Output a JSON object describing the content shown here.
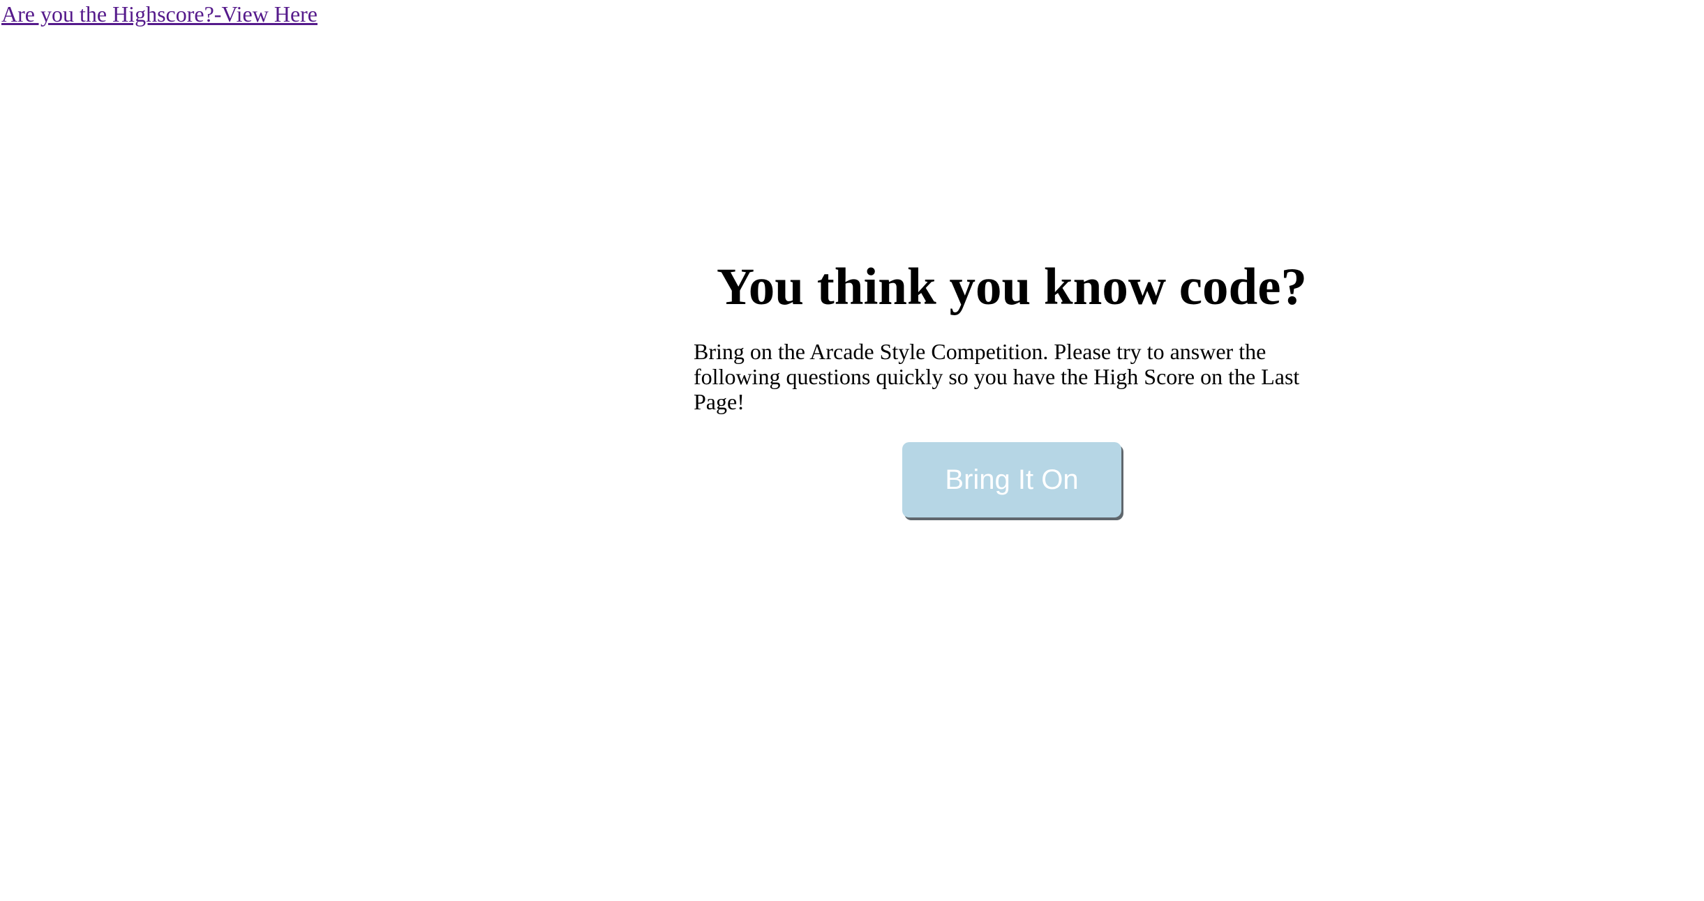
{
  "nav": {
    "highscore_link": "Are you the Highscore?-View Here"
  },
  "main": {
    "title": "You think you know code?",
    "intro": "Bring on the Arcade Style Competition. Please try to answer the following questions quickly so you have the High Score on the Last Page!",
    "start_button": "Bring It On"
  },
  "colors": {
    "link": "#551a8b",
    "button_bg": "#b6d6e5",
    "button_text": "#ffffff",
    "button_shadow": "#5f676d"
  }
}
